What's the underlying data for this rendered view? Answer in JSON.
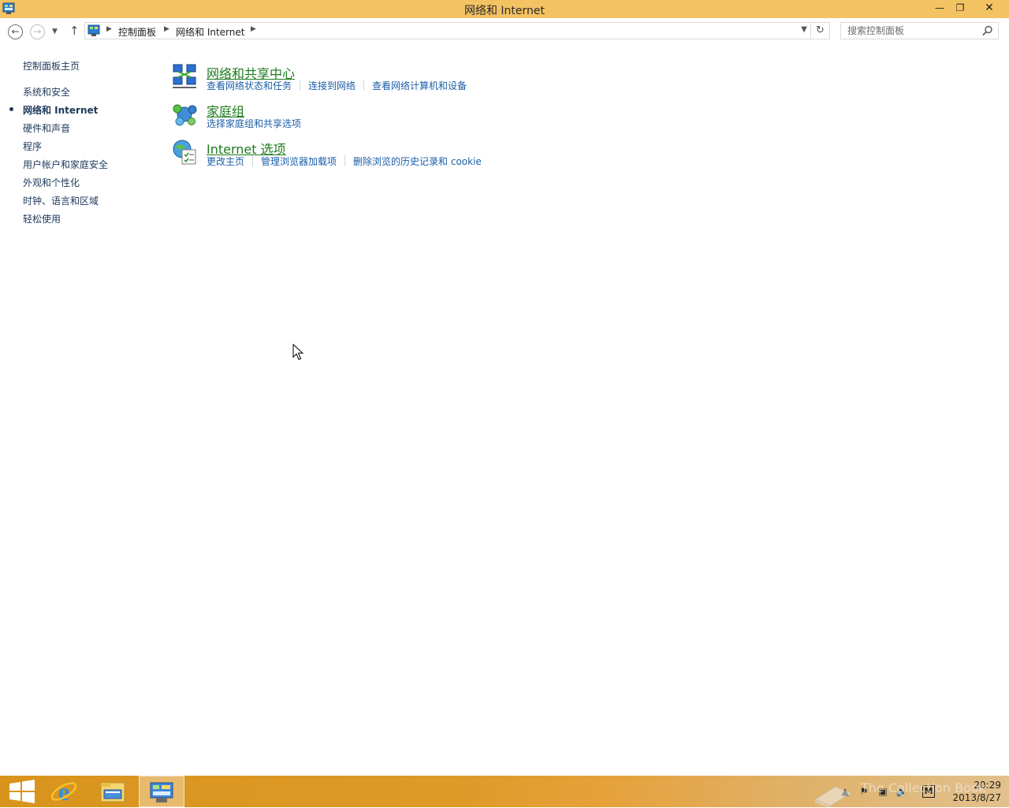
{
  "window": {
    "title": "网络和 Internet",
    "minimize_glyph": "—",
    "maximize_glyph": "❐",
    "close_glyph": "✕"
  },
  "nav": {
    "back_icon": "arrow-left-icon",
    "forward_icon": "arrow-right-icon",
    "recent_icon": "chevron-down-icon",
    "up_icon": "arrow-up-icon",
    "breadcrumb": [
      "控制面板",
      "网络和 Internet"
    ],
    "refresh_icon": "refresh-icon",
    "search_placeholder": "搜索控制面板"
  },
  "sidebar": {
    "home": "控制面板主页",
    "items": [
      {
        "label": "系统和安全",
        "current": false
      },
      {
        "label": "网络和 Internet",
        "current": true
      },
      {
        "label": "硬件和声音",
        "current": false
      },
      {
        "label": "程序",
        "current": false
      },
      {
        "label": "用户帐户和家庭安全",
        "current": false
      },
      {
        "label": "外观和个性化",
        "current": false
      },
      {
        "label": "时钟、语言和区域",
        "current": false
      },
      {
        "label": "轻松使用",
        "current": false
      }
    ]
  },
  "categories": [
    {
      "title": "网络和共享中心",
      "icon": "network-sharing-center-icon",
      "links": [
        "查看网络状态和任务",
        "连接到网络",
        "查看网络计算机和设备"
      ]
    },
    {
      "title": "家庭组",
      "icon": "homegroup-icon",
      "links": [
        "选择家庭组和共享选项"
      ]
    },
    {
      "title": "Internet 选项",
      "icon": "internet-options-icon",
      "links": [
        "更改主页",
        "管理浏览器加载项",
        "删除浏览的历史记录和 cookie"
      ]
    }
  ],
  "taskbar": {
    "items": [
      "start-icon",
      "internet-explorer-icon",
      "file-explorer-icon",
      "control-panel-icon"
    ],
    "tray_icons": [
      "show-hidden-icons",
      "action-center-flag-icon",
      "network-icon",
      "volume-icon",
      "input-method-icon"
    ],
    "ime_label": "M",
    "time": "20:29",
    "date": "2013/8/27",
    "watermark": "The Collection Book"
  },
  "colors": {
    "titlebar": "#f3c262",
    "link": "#1a5ea8",
    "category_title": "#1e7a1e",
    "sidebar_text": "#1e395b"
  }
}
